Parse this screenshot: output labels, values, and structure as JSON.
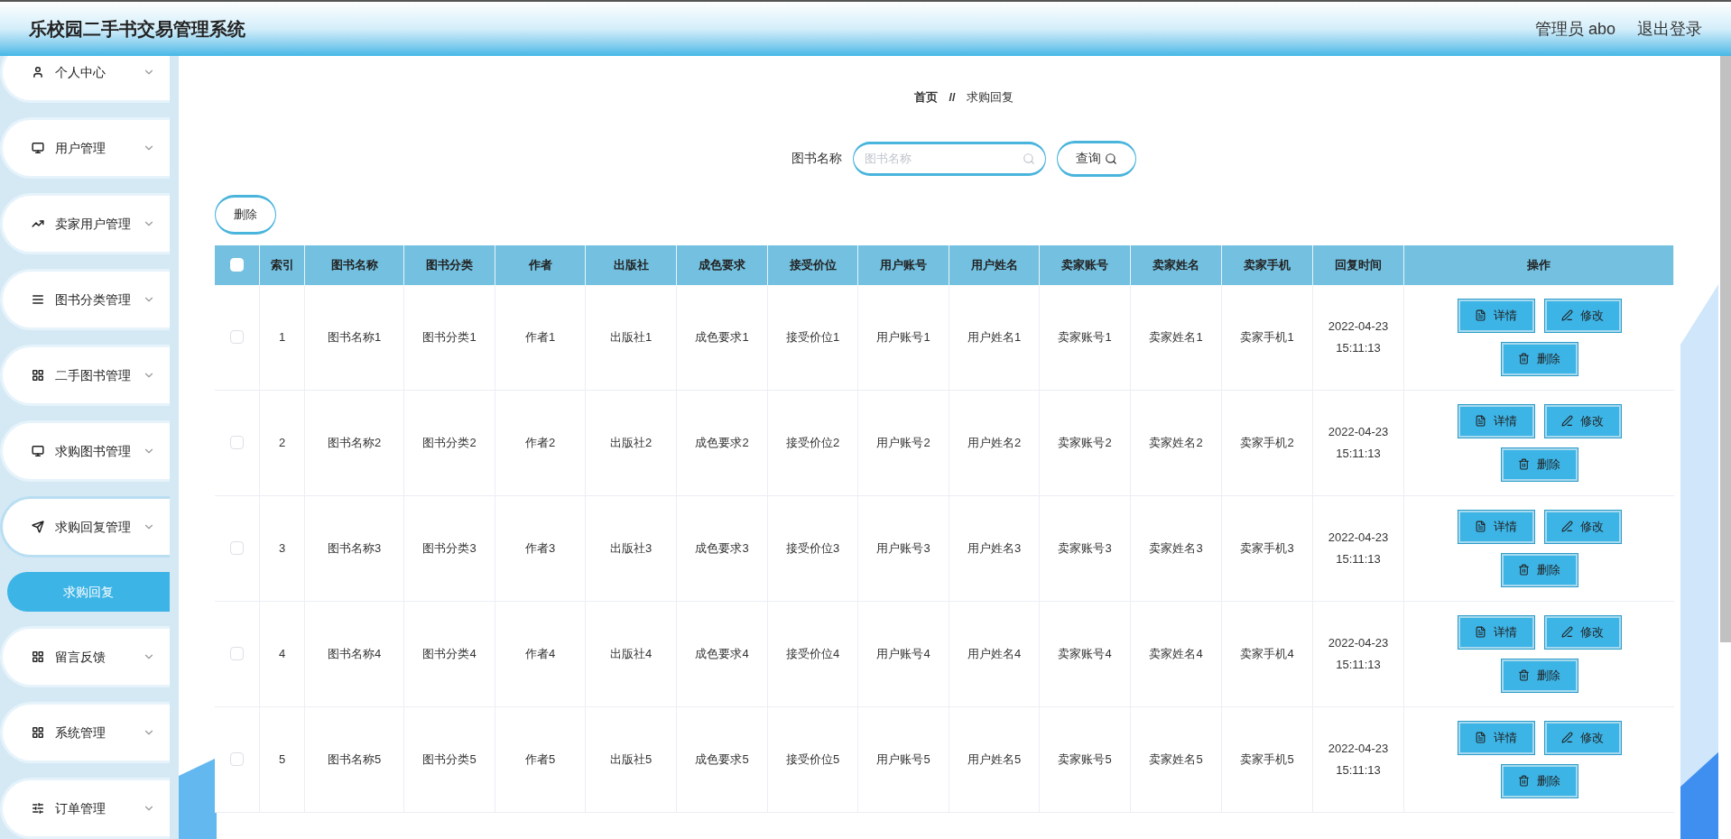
{
  "header": {
    "title": "乐校园二手书交易管理系统",
    "user": "管理员 abo",
    "logout": "退出登录"
  },
  "sidebar": {
    "items": [
      {
        "label": "个人中心",
        "expanded": false
      },
      {
        "label": "用户管理",
        "expanded": false
      },
      {
        "label": "卖家用户管理",
        "expanded": false
      },
      {
        "label": "图书分类管理",
        "expanded": false
      },
      {
        "label": "二手图书管理",
        "expanded": false
      },
      {
        "label": "求购图书管理",
        "expanded": false
      },
      {
        "label": "求购回复管理",
        "expanded": true,
        "children": [
          {
            "label": "求购回复",
            "selected": true
          }
        ]
      },
      {
        "label": "留言反馈",
        "expanded": false
      },
      {
        "label": "系统管理",
        "expanded": false
      },
      {
        "label": "订单管理",
        "expanded": false
      }
    ]
  },
  "breadcrumb": {
    "home": "首页",
    "separator": "//",
    "current": "求购回复"
  },
  "search": {
    "label": "图书名称",
    "placeholder": "图书名称",
    "button": "查询"
  },
  "bulk_delete": "删除",
  "table": {
    "select_all": false,
    "columns": [
      "索引",
      "图书名称",
      "图书分类",
      "作者",
      "出版社",
      "成色要求",
      "接受价位",
      "用户账号",
      "用户姓名",
      "卖家账号",
      "卖家姓名",
      "卖家手机",
      "回复时间",
      "操作"
    ],
    "rows": [
      {
        "checked": false,
        "cells": [
          "1",
          "图书名称1",
          "图书分类1",
          "作者1",
          "出版社1",
          "成色要求1",
          "接受价位1",
          "用户账号1",
          "用户姓名1",
          "卖家账号1",
          "卖家姓名1",
          "卖家手机1",
          "2022-04-23 15:11:13"
        ],
        "actions": [
          "详情",
          "修改",
          "删除"
        ]
      },
      {
        "checked": false,
        "cells": [
          "2",
          "图书名称2",
          "图书分类2",
          "作者2",
          "出版社2",
          "成色要求2",
          "接受价位2",
          "用户账号2",
          "用户姓名2",
          "卖家账号2",
          "卖家姓名2",
          "卖家手机2",
          "2022-04-23 15:11:13"
        ],
        "actions": [
          "详情",
          "修改",
          "删除"
        ]
      },
      {
        "checked": false,
        "cells": [
          "3",
          "图书名称3",
          "图书分类3",
          "作者3",
          "出版社3",
          "成色要求3",
          "接受价位3",
          "用户账号3",
          "用户姓名3",
          "卖家账号3",
          "卖家姓名3",
          "卖家手机3",
          "2022-04-23 15:11:13"
        ],
        "actions": [
          "详情",
          "修改",
          "删除"
        ]
      },
      {
        "checked": false,
        "cells": [
          "4",
          "图书名称4",
          "图书分类4",
          "作者4",
          "出版社4",
          "成色要求4",
          "接受价位4",
          "用户账号4",
          "用户姓名4",
          "卖家账号4",
          "卖家姓名4",
          "卖家手机4",
          "2022-04-23 15:11:13"
        ],
        "actions": [
          "详情",
          "修改",
          "删除"
        ]
      },
      {
        "checked": false,
        "cells": [
          "5",
          "图书名称5",
          "图书分类5",
          "作者5",
          "出版社5",
          "成色要求5",
          "接受价位5",
          "用户账号5",
          "用户姓名5",
          "卖家账号5",
          "卖家姓名5",
          "卖家手机5",
          "2022-04-23 15:11:13"
        ],
        "actions": [
          "详情",
          "修改",
          "删除"
        ]
      }
    ]
  }
}
